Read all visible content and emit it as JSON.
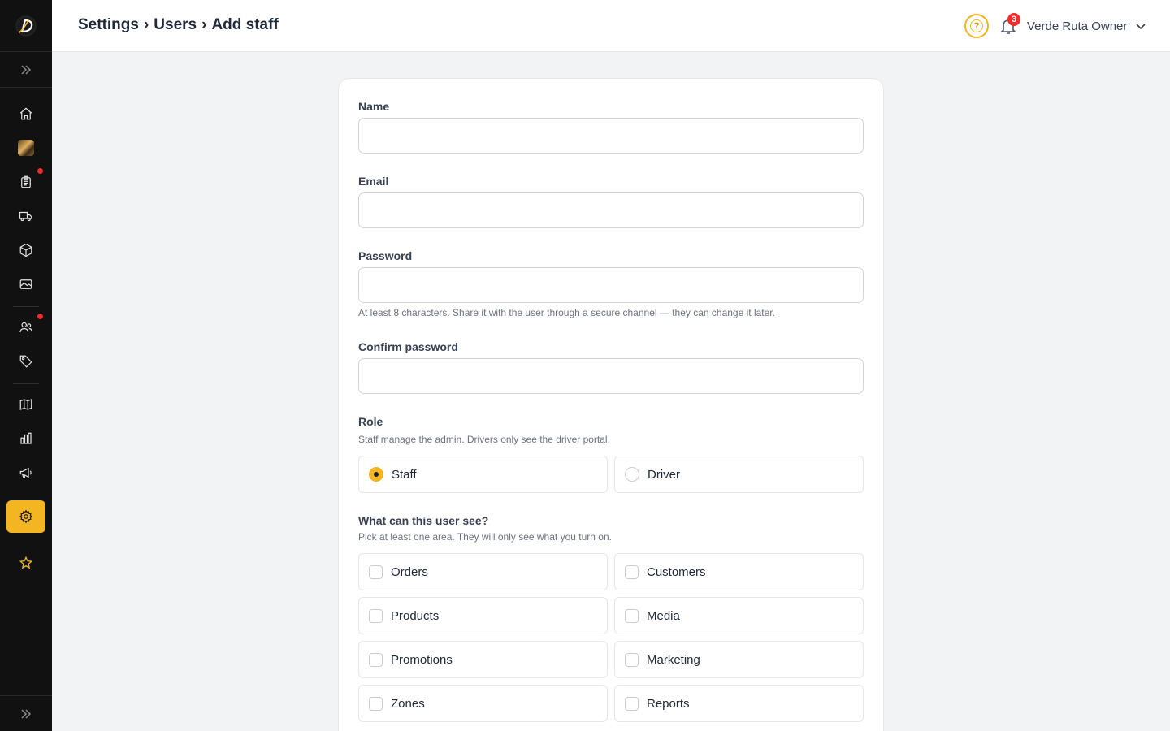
{
  "header": {
    "breadcrumb": [
      "Settings",
      "Users",
      "Add staff"
    ],
    "separator": "›",
    "help_icon_text": "?",
    "notification_count": "3",
    "user_name": "Verde Ruta Owner"
  },
  "sidebar": {
    "items": [
      {
        "name": "home",
        "icon": "home-icon"
      },
      {
        "name": "media-thumbnail",
        "icon": "image-thumbnail"
      },
      {
        "name": "orders",
        "icon": "clipboard-icon",
        "alert": true
      },
      {
        "name": "delivery",
        "icon": "truck-icon"
      },
      {
        "name": "products",
        "icon": "box-icon"
      },
      {
        "name": "media",
        "icon": "image-icon"
      },
      {
        "name": "customers",
        "icon": "users-icon",
        "alert": true
      },
      {
        "name": "promotions",
        "icon": "tag-icon"
      },
      {
        "name": "zones",
        "icon": "map-icon"
      },
      {
        "name": "reports",
        "icon": "bar-chart-icon"
      },
      {
        "name": "marketing",
        "icon": "megaphone-icon"
      },
      {
        "name": "settings",
        "icon": "gear-icon",
        "active": true
      },
      {
        "name": "favorites",
        "icon": "star-icon"
      }
    ],
    "accent": "#f3b522"
  },
  "form": {
    "name_label": "Name",
    "name_value": "",
    "email_label": "Email",
    "email_value": "",
    "password_label": "Password",
    "password_value": "",
    "password_hint": "At least 8 characters. Share it with the user through a secure channel — they can change it later.",
    "confirm_label": "Confirm password",
    "confirm_value": "",
    "role_label": "Role",
    "role_hint": "Staff manage the admin. Drivers only see the driver portal.",
    "roles": [
      {
        "label": "Staff",
        "selected": true
      },
      {
        "label": "Driver",
        "selected": false
      }
    ],
    "areas_label": "What can this user see?",
    "areas_hint": "Pick at least one area. They will only see what you turn on.",
    "areas": [
      {
        "label": "Orders",
        "checked": false
      },
      {
        "label": "Customers",
        "checked": false
      },
      {
        "label": "Products",
        "checked": false
      },
      {
        "label": "Media",
        "checked": false
      },
      {
        "label": "Promotions",
        "checked": false
      },
      {
        "label": "Marketing",
        "checked": false
      },
      {
        "label": "Zones",
        "checked": false
      },
      {
        "label": "Reports",
        "checked": false
      }
    ]
  }
}
